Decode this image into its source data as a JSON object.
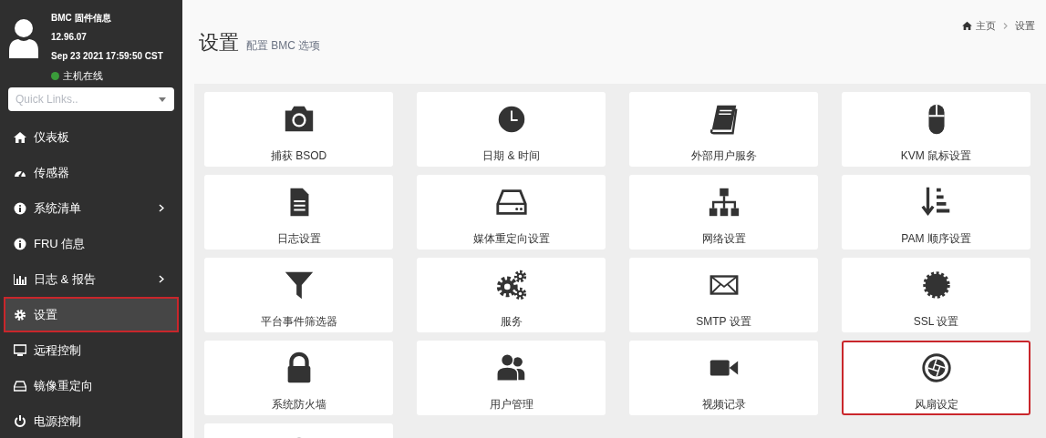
{
  "profile": {
    "title": "BMC 固件信息",
    "version": "12.96.07",
    "datetime": "Sep 23 2021 17:59:50 CST",
    "host_status": "主机在线",
    "host_online": true
  },
  "quick_links": {
    "placeholder": "Quick Links.."
  },
  "sidebar": {
    "items": [
      {
        "label": "仪表板",
        "has_submenu": false,
        "selected": false
      },
      {
        "label": "传感器",
        "has_submenu": false,
        "selected": false
      },
      {
        "label": "系统清单",
        "has_submenu": true,
        "selected": false
      },
      {
        "label": "FRU 信息",
        "has_submenu": false,
        "selected": false
      },
      {
        "label": "日志 & 报告",
        "has_submenu": true,
        "selected": false
      },
      {
        "label": "设置",
        "has_submenu": false,
        "selected": true
      },
      {
        "label": "远程控制",
        "has_submenu": false,
        "selected": false
      },
      {
        "label": "镜像重定向",
        "has_submenu": false,
        "selected": false
      },
      {
        "label": "电源控制",
        "has_submenu": false,
        "selected": false
      }
    ]
  },
  "header": {
    "title": "设置",
    "subtitle": "配置 BMC 选项",
    "breadcrumb": [
      "主页",
      "设置"
    ]
  },
  "tiles": [
    {
      "label": "捕获 BSOD",
      "highlighted": false
    },
    {
      "label": "日期 & 时间",
      "highlighted": false
    },
    {
      "label": "外部用户服务",
      "highlighted": false
    },
    {
      "label": "KVM 鼠标设置",
      "highlighted": false
    },
    {
      "label": "日志设置",
      "highlighted": false
    },
    {
      "label": "媒体重定向设置",
      "highlighted": false
    },
    {
      "label": "网络设置",
      "highlighted": false
    },
    {
      "label": "PAM 顺序设置",
      "highlighted": false
    },
    {
      "label": "平台事件筛选器",
      "highlighted": false
    },
    {
      "label": "服务",
      "highlighted": false
    },
    {
      "label": "SMTP 设置",
      "highlighted": false
    },
    {
      "label": "SSL 设置",
      "highlighted": false
    },
    {
      "label": "系统防火墙",
      "highlighted": false
    },
    {
      "label": "用户管理",
      "highlighted": false
    },
    {
      "label": "视频记录",
      "highlighted": false
    },
    {
      "label": "风扇设定",
      "highlighted": true
    },
    {
      "highlighted": false
    }
  ]
}
